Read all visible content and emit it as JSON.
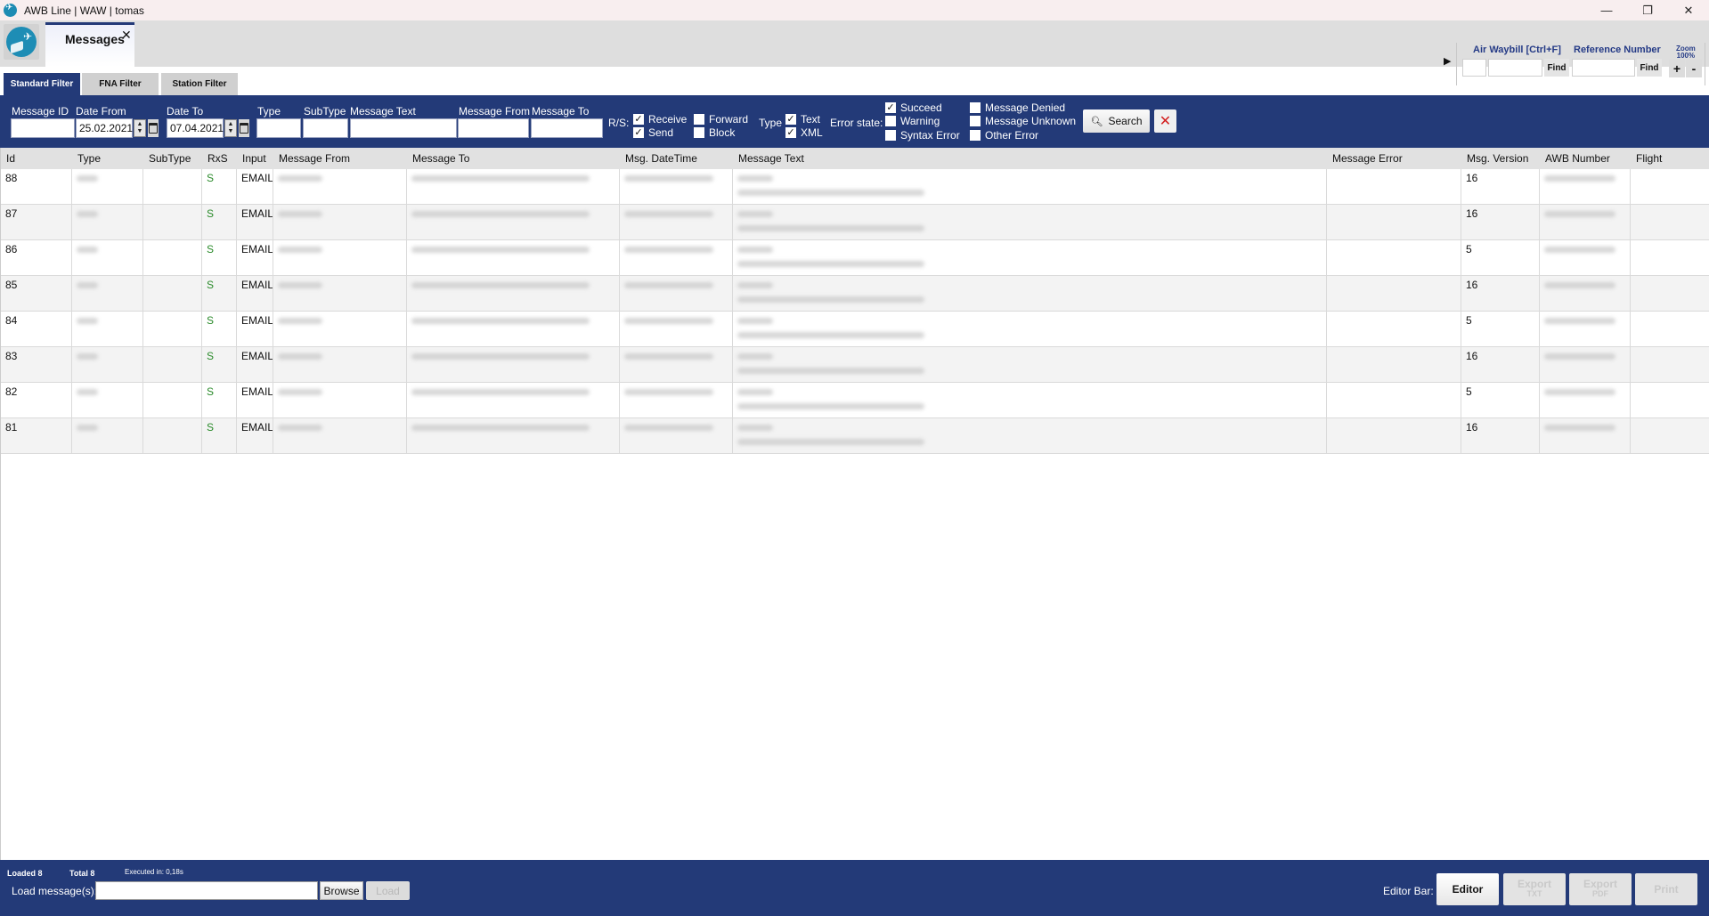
{
  "window": {
    "title": "AWB Line | WAW | tomas",
    "controls": {
      "minimize": "—",
      "maximize": "❐",
      "close": "✕"
    }
  },
  "tabs": {
    "document_tab": {
      "label": "Messages",
      "close": "✕"
    }
  },
  "quick_search": {
    "expand_arrow": "▶",
    "air_waybill_label": "Air Waybill [Ctrl+F]",
    "air_waybill_prefix_value": "",
    "air_waybill_number_value": "",
    "find_label": "Find",
    "reference_label": "Reference Number",
    "reference_value": "",
    "zoom_label": "Zoom",
    "zoom_value": "100%",
    "zoom_in": "+",
    "zoom_out": "-"
  },
  "filter_tabs": [
    {
      "label": "Standard Filter",
      "active": true
    },
    {
      "label": "FNA Filter",
      "active": false
    },
    {
      "label": "Station Filter",
      "active": false
    }
  ],
  "filter": {
    "message_id": {
      "label": "Message ID",
      "value": ""
    },
    "date_from": {
      "label": "Date From",
      "value": "25.02.2021"
    },
    "date_to": {
      "label": "Date To",
      "value": "07.04.2021"
    },
    "type": {
      "label": "Type",
      "value": ""
    },
    "subtype": {
      "label": "SubType",
      "value": ""
    },
    "message_text": {
      "label": "Message Text",
      "value": ""
    },
    "message_from": {
      "label": "Message From",
      "value": ""
    },
    "message_to": {
      "label": "Message To",
      "value": ""
    },
    "rs_label": "R/S:",
    "rs_options": [
      {
        "label": "Receive",
        "checked": true
      },
      {
        "label": "Send",
        "checked": true
      },
      {
        "label": "Forward",
        "checked": false
      },
      {
        "label": "Block",
        "checked": false
      }
    ],
    "type_label": "Type",
    "type_options": [
      {
        "label": "Text",
        "checked": true
      },
      {
        "label": "XML",
        "checked": true
      }
    ],
    "error_state_label": "Error state:",
    "error_options": [
      {
        "label": "Succeed",
        "checked": true
      },
      {
        "label": "Warning",
        "checked": false
      },
      {
        "label": "Syntax Error",
        "checked": false
      },
      {
        "label": "Message Denied",
        "checked": false
      },
      {
        "label": "Message Unknown",
        "checked": false
      },
      {
        "label": "Other Error",
        "checked": false
      }
    ],
    "search_label": "Search",
    "clear_icon": "✕",
    "check_glyph": "✓"
  },
  "grid": {
    "columns": [
      "Id",
      "Type",
      "SubType",
      "RxS",
      "Input",
      "Message From",
      "Message To",
      "Msg. DateTime",
      "Message Text",
      "Message Error",
      "Msg. Version",
      "AWB Number",
      "Flight"
    ],
    "rows": [
      {
        "id": "88",
        "subtype": "",
        "rxs": "S",
        "input": "EMAIL",
        "message_error": "",
        "msg_version": "16",
        "flight": ""
      },
      {
        "id": "87",
        "subtype": "",
        "rxs": "S",
        "input": "EMAIL",
        "message_error": "",
        "msg_version": "16",
        "flight": ""
      },
      {
        "id": "86",
        "subtype": "",
        "rxs": "S",
        "input": "EMAIL",
        "message_error": "",
        "msg_version": "5",
        "flight": ""
      },
      {
        "id": "85",
        "subtype": "",
        "rxs": "S",
        "input": "EMAIL",
        "message_error": "",
        "msg_version": "16",
        "flight": ""
      },
      {
        "id": "84",
        "subtype": "",
        "rxs": "S",
        "input": "EMAIL",
        "message_error": "",
        "msg_version": "5",
        "flight": ""
      },
      {
        "id": "83",
        "subtype": "",
        "rxs": "S",
        "input": "EMAIL",
        "message_error": "",
        "msg_version": "16",
        "flight": ""
      },
      {
        "id": "82",
        "subtype": "",
        "rxs": "S",
        "input": "EMAIL",
        "message_error": "",
        "msg_version": "5",
        "flight": ""
      },
      {
        "id": "81",
        "subtype": "",
        "rxs": "S",
        "input": "EMAIL",
        "message_error": "",
        "msg_version": "16",
        "flight": ""
      }
    ]
  },
  "footer": {
    "loaded": "Loaded 8",
    "total": "Total 8",
    "executed": "Executed in: 0,18s",
    "load_label": "Load message(s):",
    "load_value": "",
    "browse_label": "Browse",
    "load_button": "Load",
    "editor_bar_label": "Editor Bar:",
    "editor_buttons": [
      {
        "label": "Editor",
        "sub": "",
        "enabled": true
      },
      {
        "label": "Export",
        "sub": "TXT",
        "enabled": false
      },
      {
        "label": "Export",
        "sub": "PDF",
        "enabled": false
      },
      {
        "label": "Print",
        "sub": "",
        "enabled": false
      }
    ]
  },
  "colors": {
    "accent_navy": "#233a78",
    "rxs_green": "#2a8a2a",
    "clear_red": "#d32020",
    "quick_search_label": "#243a86"
  }
}
